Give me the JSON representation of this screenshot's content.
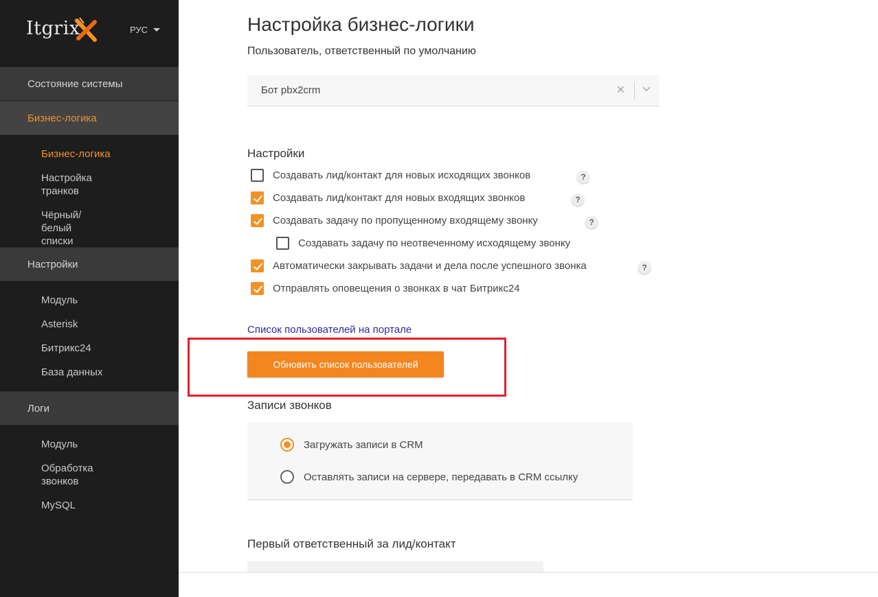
{
  "app": {
    "logo_text": "Itgrix",
    "language": "РУС"
  },
  "sidebar": {
    "sections": [
      {
        "label": "Состояние системы",
        "active": false
      },
      {
        "label": "Бизнес-логика",
        "active": true,
        "items": [
          {
            "label": "Бизнес-логика",
            "active": true
          },
          {
            "label": "Настройка транков",
            "active": false
          },
          {
            "label": "Чёрный/белый списки",
            "active": false
          }
        ]
      },
      {
        "label": "Настройки",
        "active": false,
        "items": [
          {
            "label": "Модуль"
          },
          {
            "label": "Asterisk"
          },
          {
            "label": "Битрикс24"
          },
          {
            "label": "База данных"
          }
        ]
      },
      {
        "label": "Логи",
        "active": false,
        "items": [
          {
            "label": "Модуль"
          },
          {
            "label": "Обработка звонков"
          },
          {
            "label": "MySQL"
          }
        ]
      }
    ]
  },
  "main": {
    "title": "Настройка бизнес-логики",
    "default_user_label": "Пользователь, ответственный по умолчанию",
    "default_user_value": "Бот pbx2crm",
    "settings_heading": "Настройки",
    "settings": [
      {
        "label": "Создавать лид/контакт для новых исходящих звонков",
        "checked": false,
        "help": "?"
      },
      {
        "label": "Создавать лид/контакт для новых входящих звонков",
        "checked": true,
        "help": "?"
      },
      {
        "label": "Создавать задачу по пропущенному входящему звонку",
        "checked": true,
        "help": "?"
      },
      {
        "label": "Создавать задачу по неотвеченному исходящему звонку",
        "checked": false
      },
      {
        "label": "Автоматически закрывать задачи и дела после успешного звонка",
        "checked": true,
        "help": "?"
      },
      {
        "label": "Отправлять оповещения о звонках в чат Битрикс24",
        "checked": true
      }
    ],
    "users_link": "Список пользователей на портале",
    "refresh_button": "Обновить список пользователей",
    "recordings_heading": "Записи звонков",
    "recordings_options": [
      {
        "label": "Загружать записи в CRM",
        "selected": true
      },
      {
        "label": "Оставлять записи на сервере, передавать в CRM ссылку",
        "selected": false
      }
    ],
    "first_responsible_heading": "Первый ответственный за лид/контакт"
  },
  "colors": {
    "accent": "#f39224",
    "sidebar_bg": "#1d1d1d",
    "highlight_border": "#e0202a",
    "link": "#2b2b9a"
  }
}
